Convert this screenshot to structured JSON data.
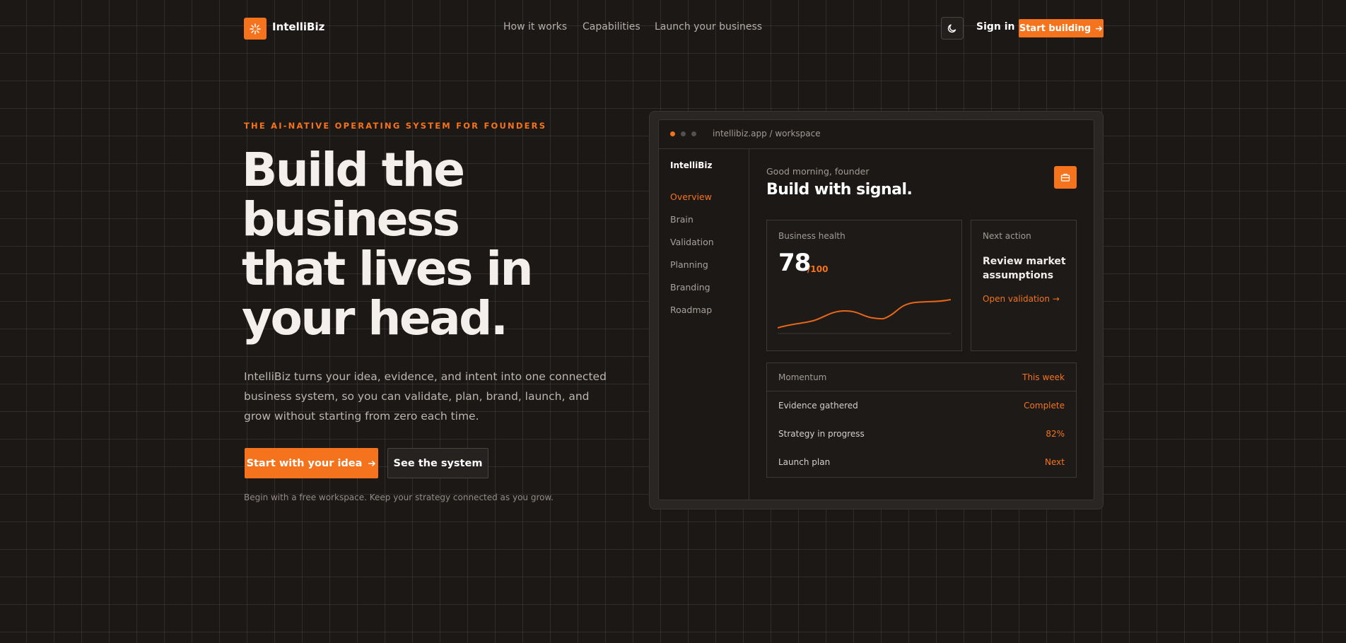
{
  "nav": {
    "brand": "IntelliBiz",
    "links": [
      "How it works",
      "Capabilities",
      "Launch your business"
    ],
    "signin": "Sign in",
    "cta": "Start building"
  },
  "hero": {
    "eyebrow": "THE AI-NATIVE OPERATING SYSTEM FOR FOUNDERS",
    "title_lines": [
      "Build the",
      "business",
      "that lives in",
      "your head."
    ],
    "description": "IntelliBiz turns your idea, evidence, and intent into one connected business system, so you can validate, plan, brand, launch, and grow without starting from zero each time.",
    "primary_cta": "Start with your idea",
    "secondary_cta": "See the system",
    "hint": "Begin with a free workspace. Keep your strategy connected as you grow."
  },
  "app": {
    "url": "intellibiz.app / workspace",
    "sidebar_brand": "IntelliBiz",
    "sidebar_items": [
      "Overview",
      "Brain",
      "Validation",
      "Planning",
      "Branding",
      "Roadmap"
    ],
    "active_item": "Overview",
    "greeting": "Good morning, founder",
    "title": "Build with signal.",
    "health": {
      "label": "Business health",
      "score": "78",
      "max": "/100"
    },
    "next_action": {
      "label": "Next action",
      "title": "Review market assumptions",
      "link": "Open validation →"
    },
    "momentum": {
      "label": "Momentum",
      "period": "This week",
      "rows": [
        {
          "key": "Evidence gathered",
          "value": "Complete"
        },
        {
          "key": "Strategy in progress",
          "value": "82%"
        },
        {
          "key": "Launch plan",
          "value": "Next"
        }
      ]
    }
  },
  "colors": {
    "accent": "#f5731c",
    "background": "#1c1816"
  },
  "icons": {
    "logo": "sparkle-icon",
    "theme": "moon-icon",
    "arrow": "arrow-right-icon",
    "action": "briefcase-icon"
  }
}
